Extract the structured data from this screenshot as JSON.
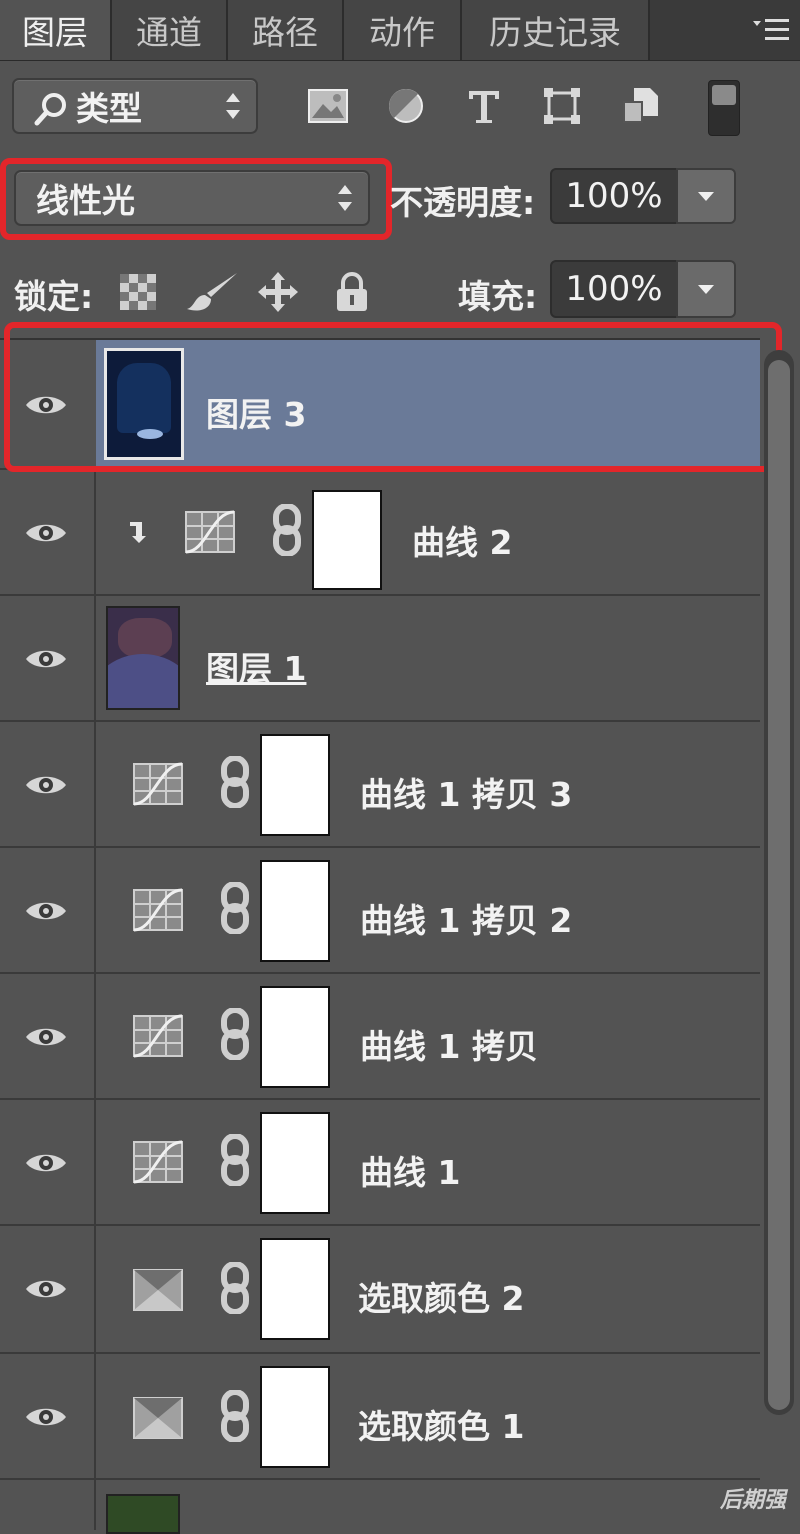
{
  "tabs": [
    "图层",
    "通道",
    "路径",
    "动作",
    "历史记录"
  ],
  "filter": {
    "label": "类型",
    "icon": "search-icon"
  },
  "filter_icons": [
    "image-filter-icon",
    "adjustment-filter-icon",
    "type-filter-icon",
    "shape-filter-icon",
    "smart-object-filter-icon"
  ],
  "blend_mode": "线性光",
  "opacity": {
    "label": "不透明度:",
    "value": "100%"
  },
  "lock": {
    "label": "锁定:",
    "icons": [
      "lock-transparent-pixels-icon",
      "lock-image-pixels-icon",
      "lock-position-icon",
      "lock-all-icon"
    ]
  },
  "fill": {
    "label": "填充:",
    "value": "100%"
  },
  "layers": [
    {
      "name": "图层 3",
      "type": "pixel",
      "selected": true
    },
    {
      "name": "曲线 2",
      "type": "curves",
      "clipped": true
    },
    {
      "name": "图层 1",
      "type": "pixel"
    },
    {
      "name": "曲线 1 拷贝 3",
      "type": "curves"
    },
    {
      "name": "曲线 1 拷贝 2",
      "type": "curves"
    },
    {
      "name": "曲线 1 拷贝",
      "type": "curves"
    },
    {
      "name": "曲线 1",
      "type": "curves"
    },
    {
      "name": "选取颜色 2",
      "type": "selective-color"
    },
    {
      "name": "选取颜色 1",
      "type": "selective-color"
    }
  ],
  "watermark": "后期强",
  "colors": {
    "panel_bg": "#535353",
    "selected_row": "#6a7a98",
    "highlight_box": "#e3262a"
  }
}
